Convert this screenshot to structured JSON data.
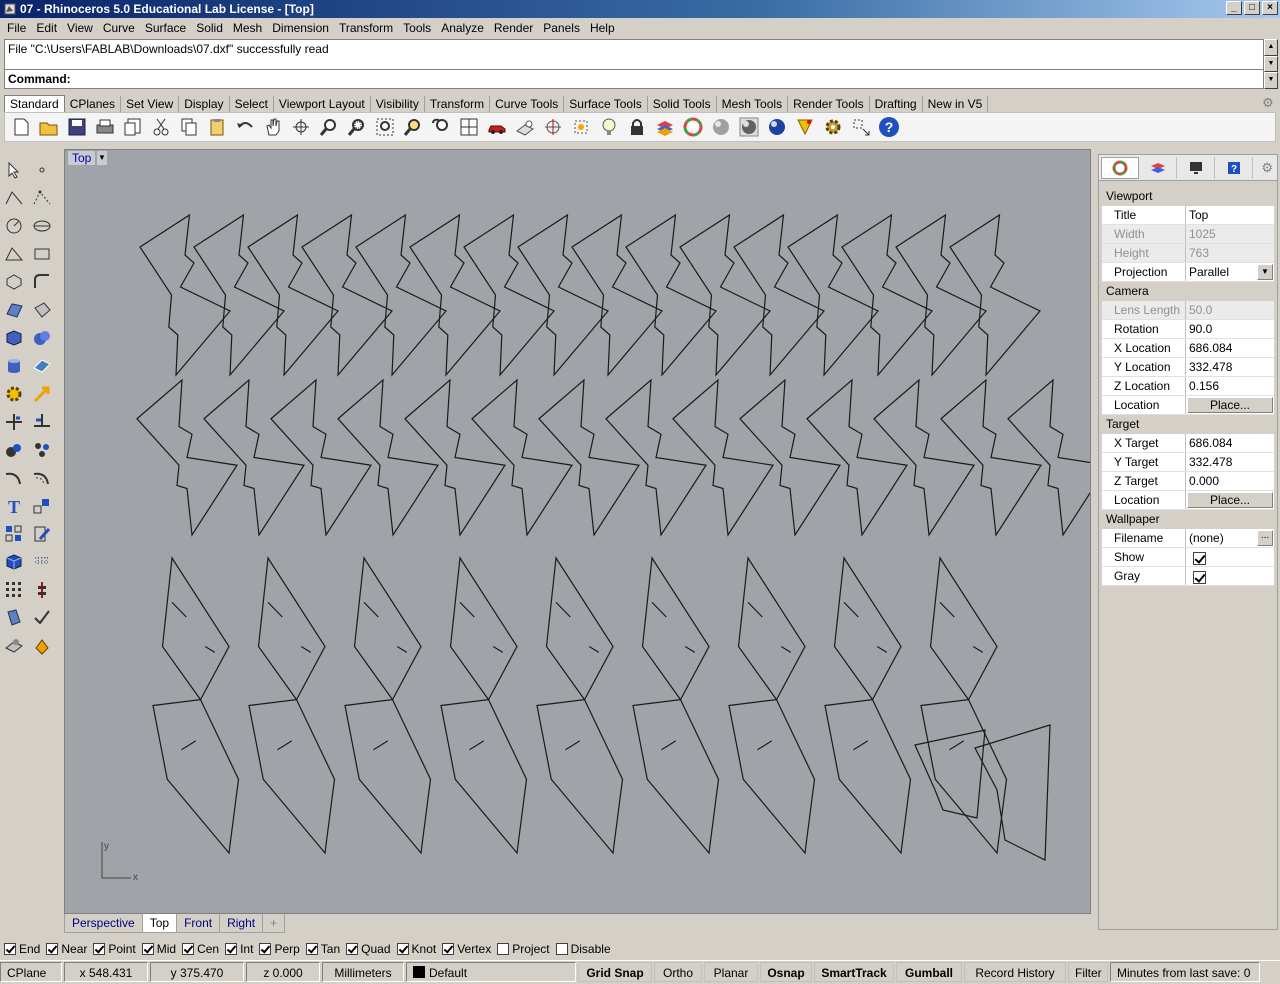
{
  "window": {
    "title": "07 - Rhinoceros 5.0 Educational Lab License - [Top]",
    "controls": [
      "_",
      "□",
      "×"
    ]
  },
  "menu": [
    "File",
    "Edit",
    "View",
    "Curve",
    "Surface",
    "Solid",
    "Mesh",
    "Dimension",
    "Transform",
    "Tools",
    "Analyze",
    "Render",
    "Panels",
    "Help"
  ],
  "command": {
    "history": "File \"C:\\Users\\FABLAB\\Downloads\\07.dxf\" successfully read",
    "prompt": "Command:"
  },
  "toolbar_tabs": [
    "Standard",
    "CPlanes",
    "Set View",
    "Display",
    "Select",
    "Viewport Layout",
    "Visibility",
    "Transform",
    "Curve Tools",
    "Surface Tools",
    "Solid Tools",
    "Mesh Tools",
    "Render Tools",
    "Drafting",
    "New in V5"
  ],
  "viewport": {
    "title": "Top",
    "axis_y": "y",
    "axis_x": "x",
    "background": "#a0a4a8"
  },
  "viewport_tabs": [
    "Perspective",
    "Top",
    "Front",
    "Right",
    "+"
  ],
  "properties": {
    "viewport_section": "Viewport",
    "title_label": "Title",
    "title_value": "Top",
    "width_label": "Width",
    "width_value": "1025",
    "height_label": "Height",
    "height_value": "763",
    "projection_label": "Projection",
    "projection_value": "Parallel",
    "camera_section": "Camera",
    "lens_label": "Lens Length",
    "lens_value": "50.0",
    "rotation_label": "Rotation",
    "rotation_value": "90.0",
    "xloc_label": "X Location",
    "xloc_value": "686.084",
    "yloc_label": "Y Location",
    "yloc_value": "332.478",
    "zloc_label": "Z Location",
    "zloc_value": "0.156",
    "loc_label": "Location",
    "place_button": "Place...",
    "target_section": "Target",
    "xt_label": "X Target",
    "xt_value": "686.084",
    "yt_label": "Y Target",
    "yt_value": "332.478",
    "zt_label": "Z Target",
    "zt_value": "0.000",
    "tloc_label": "Location",
    "tplace_button": "Place...",
    "wallpaper_section": "Wallpaper",
    "filename_label": "Filename",
    "filename_value": "(none)",
    "filename_button": "...",
    "show_label": "Show",
    "gray_label": "Gray"
  },
  "osnaps": [
    {
      "label": "End",
      "checked": true
    },
    {
      "label": "Near",
      "checked": true
    },
    {
      "label": "Point",
      "checked": true
    },
    {
      "label": "Mid",
      "checked": true
    },
    {
      "label": "Cen",
      "checked": true
    },
    {
      "label": "Int",
      "checked": true
    },
    {
      "label": "Perp",
      "checked": true
    },
    {
      "label": "Tan",
      "checked": true
    },
    {
      "label": "Quad",
      "checked": true
    },
    {
      "label": "Knot",
      "checked": true
    },
    {
      "label": "Vertex",
      "checked": true
    },
    {
      "label": "Project",
      "checked": false
    },
    {
      "label": "Disable",
      "checked": false
    }
  ],
  "status": {
    "cplane": "CPlane",
    "x": "x 548.431",
    "y": "y 375.470",
    "z": "z 0.000",
    "units": "Millimeters",
    "layer": "Default",
    "grid_snap": "Grid Snap",
    "ortho": "Ortho",
    "planar": "Planar",
    "osnap": "Osnap",
    "smarttrack": "SmartTrack",
    "gumball": "Gumball",
    "record_history": "Record History",
    "filter": "Filter",
    "minutes": "Minutes from last save: 0"
  },
  "icons": [
    "new-file-icon",
    "open-icon",
    "save-icon",
    "print-icon",
    "import-icon",
    "cut-icon",
    "copy-icon",
    "paste-icon",
    "undo-icon",
    "pan-icon",
    "rotate-view-icon",
    "zoom-icon",
    "zoom-window-icon",
    "zoom-extents-icon",
    "zoom-selected-icon",
    "undo-view-icon",
    "four-viewports-icon",
    "car-icon",
    "cplane-icon",
    "osnap-icon",
    "grid-icon",
    "light-icon",
    "lock-icon",
    "layer-icon",
    "color-wheel-icon",
    "shade-icon",
    "rendered-icon",
    "render-icon",
    "point-edit-icon",
    "options-icon",
    "dimension-icon",
    "help-icon"
  ]
}
